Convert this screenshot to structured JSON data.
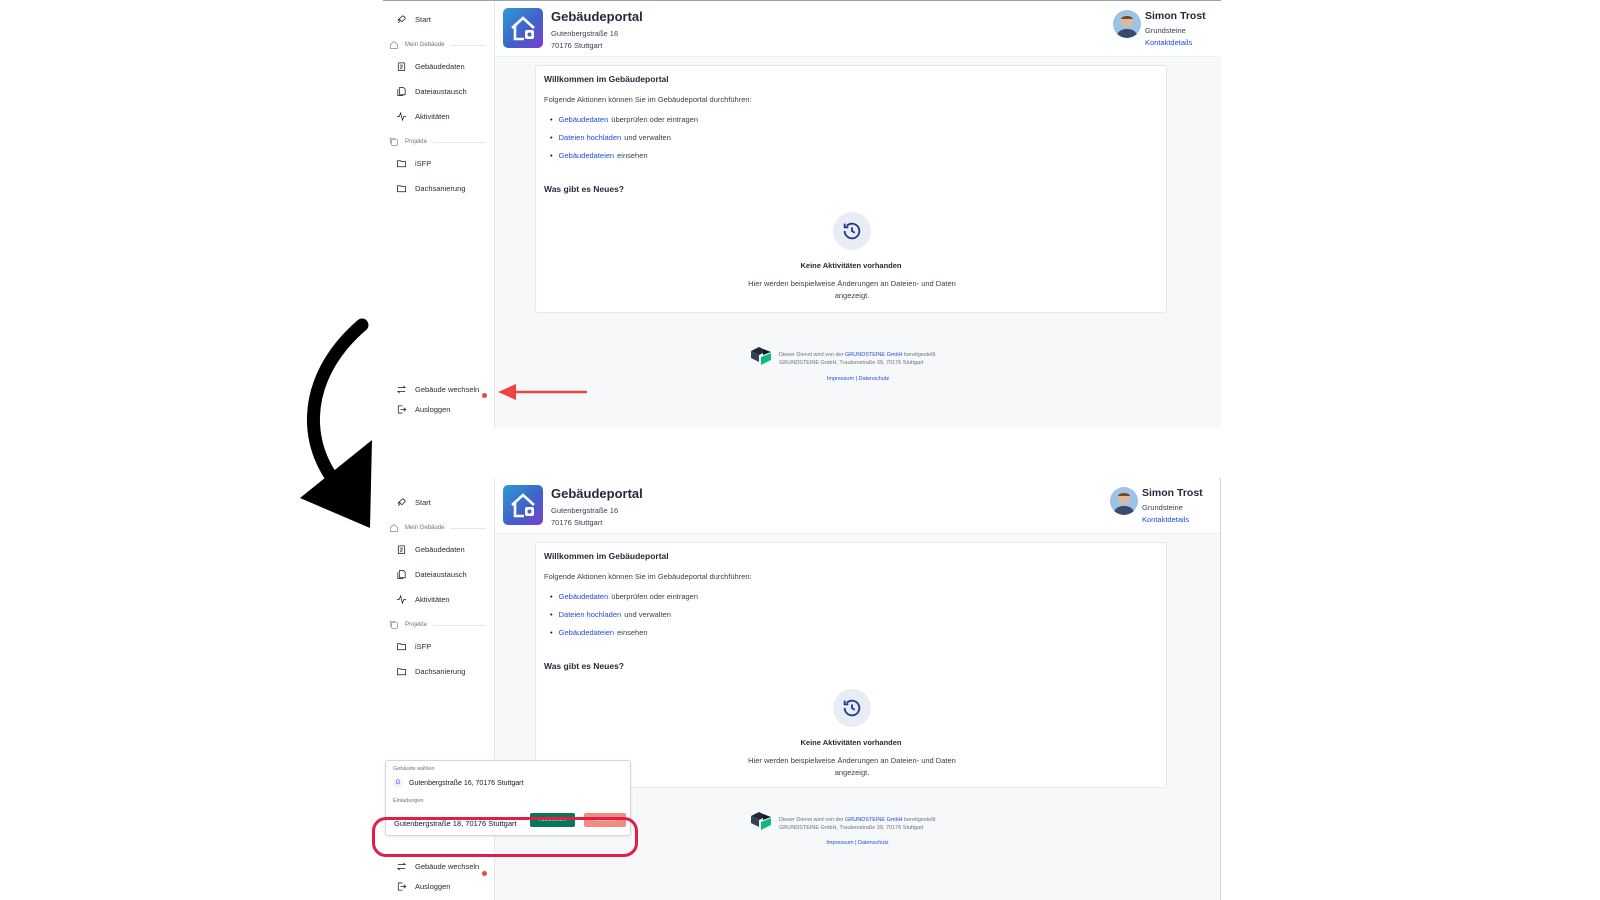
{
  "sidebar": {
    "start": "Start",
    "section_building": "Mein Gebäude",
    "building_items": [
      "Gebäudedaten",
      "Dateiaustausch",
      "Aktivitäten"
    ],
    "section_projects": "Projekte",
    "project_items": [
      "iSFP",
      "Dachsanierung"
    ],
    "switch_building": "Gebäude wechseln",
    "logout": "Ausloggen"
  },
  "header": {
    "title": "Gebäudeportal",
    "street": "Gutenbergstraße 16",
    "city": "70176 Stuttgart",
    "user_name": "Simon Trost",
    "user_org": "Grundsteine",
    "contact_link": "Kontaktdetails"
  },
  "welcome": {
    "title": "Willkommen im Gebäudeportal",
    "intro": "Folgende Aktionen können Sie im Gebäudeportal durchführen:",
    "items": [
      {
        "link": "Gebäudedaten",
        "rest": "überprüfen oder eintragen"
      },
      {
        "link": "Dateien hochladen",
        "rest": "und verwalten"
      },
      {
        "link": "Gebäudedateien",
        "rest": "einsehen"
      }
    ],
    "news_title": "Was gibt es Neues?",
    "empty_title": "Keine Aktivitäten vorhanden",
    "empty_text": "Hier werden beispielweise Änderungen an Dateien- und Daten angezeigt."
  },
  "footer": {
    "line1_pre": "Dieser Dienst wird von der",
    "line1_brand": "GRUNDSTEINE GmbH",
    "line1_post": "bereitgestellt.",
    "line2": "GRUNDSTEINE GmbH, Traubenstraße 39, 70176 Stuttgart",
    "links": "Impressum | Datenschutz"
  },
  "popup": {
    "select_label": "Gebäude wählen",
    "current_building": "Gutenbergstraße 16, 70176 Stuttgart",
    "current_badge": "G",
    "invites_label": "Einladungen",
    "invite_address": "Gutenbergstraße 18, 70176 Stuttgart",
    "accept": "Annehmen",
    "decline": "Ablehnen"
  },
  "colors": {
    "link": "#1d4ed8",
    "accept": "#047857",
    "decline": "#f28b82",
    "highlight": "#e11d48",
    "notification_dot": "#ef4444"
  }
}
